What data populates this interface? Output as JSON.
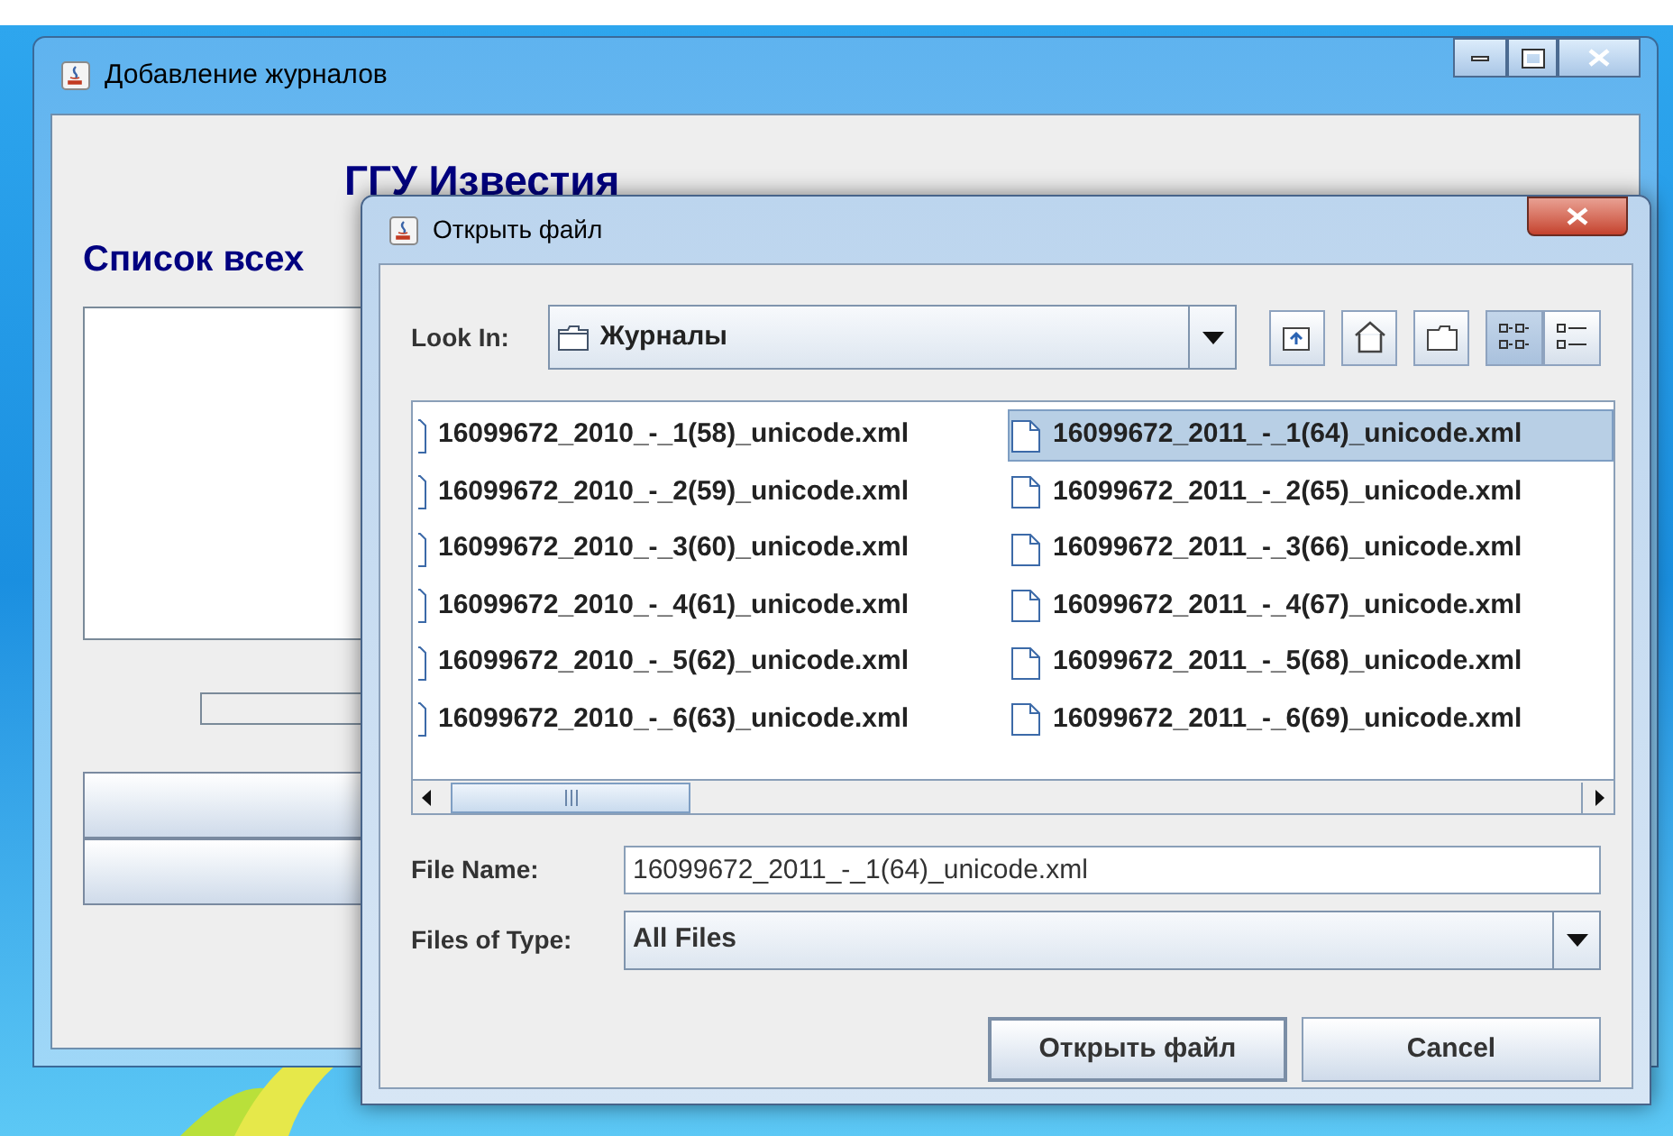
{
  "main_window": {
    "title": "Добавление журналов",
    "heading": "ГГУ Известия",
    "subheading": "Список всех"
  },
  "dialog": {
    "title": "Открыть файл",
    "look_in": {
      "label": "Look In:",
      "value": "Журналы"
    },
    "view_buttons": [
      {
        "kind": "list",
        "selected": true
      },
      {
        "kind": "details",
        "selected": false
      }
    ],
    "files": [
      {
        "name": "16099672_2010_-_1(58)_unicode.xml",
        "selected": false
      },
      {
        "name": "16099672_2010_-_2(59)_unicode.xml",
        "selected": false
      },
      {
        "name": "16099672_2010_-_3(60)_unicode.xml",
        "selected": false
      },
      {
        "name": "16099672_2010_-_4(61)_unicode.xml",
        "selected": false
      },
      {
        "name": "16099672_2010_-_5(62)_unicode.xml",
        "selected": false
      },
      {
        "name": "16099672_2010_-_6(63)_unicode.xml",
        "selected": false
      },
      {
        "name": "16099672_2011_-_1(64)_unicode.xml",
        "selected": true
      },
      {
        "name": "16099672_2011_-_2(65)_unicode.xml",
        "selected": false
      },
      {
        "name": "16099672_2011_-_3(66)_unicode.xml",
        "selected": false
      },
      {
        "name": "16099672_2011_-_4(67)_unicode.xml",
        "selected": false
      },
      {
        "name": "16099672_2011_-_5(68)_unicode.xml",
        "selected": false
      },
      {
        "name": "16099672_2011_-_6(69)_unicode.xml",
        "selected": false
      }
    ],
    "file_name": {
      "label": "File Name:",
      "value": "16099672_2011_-_1(64)_unicode.xml"
    },
    "file_type": {
      "label": "Files of Type:",
      "value": "All Files"
    },
    "buttons": [
      {
        "label": "Открыть файл",
        "kind": "default"
      },
      {
        "label": "Cancel",
        "kind": "normal"
      }
    ]
  }
}
